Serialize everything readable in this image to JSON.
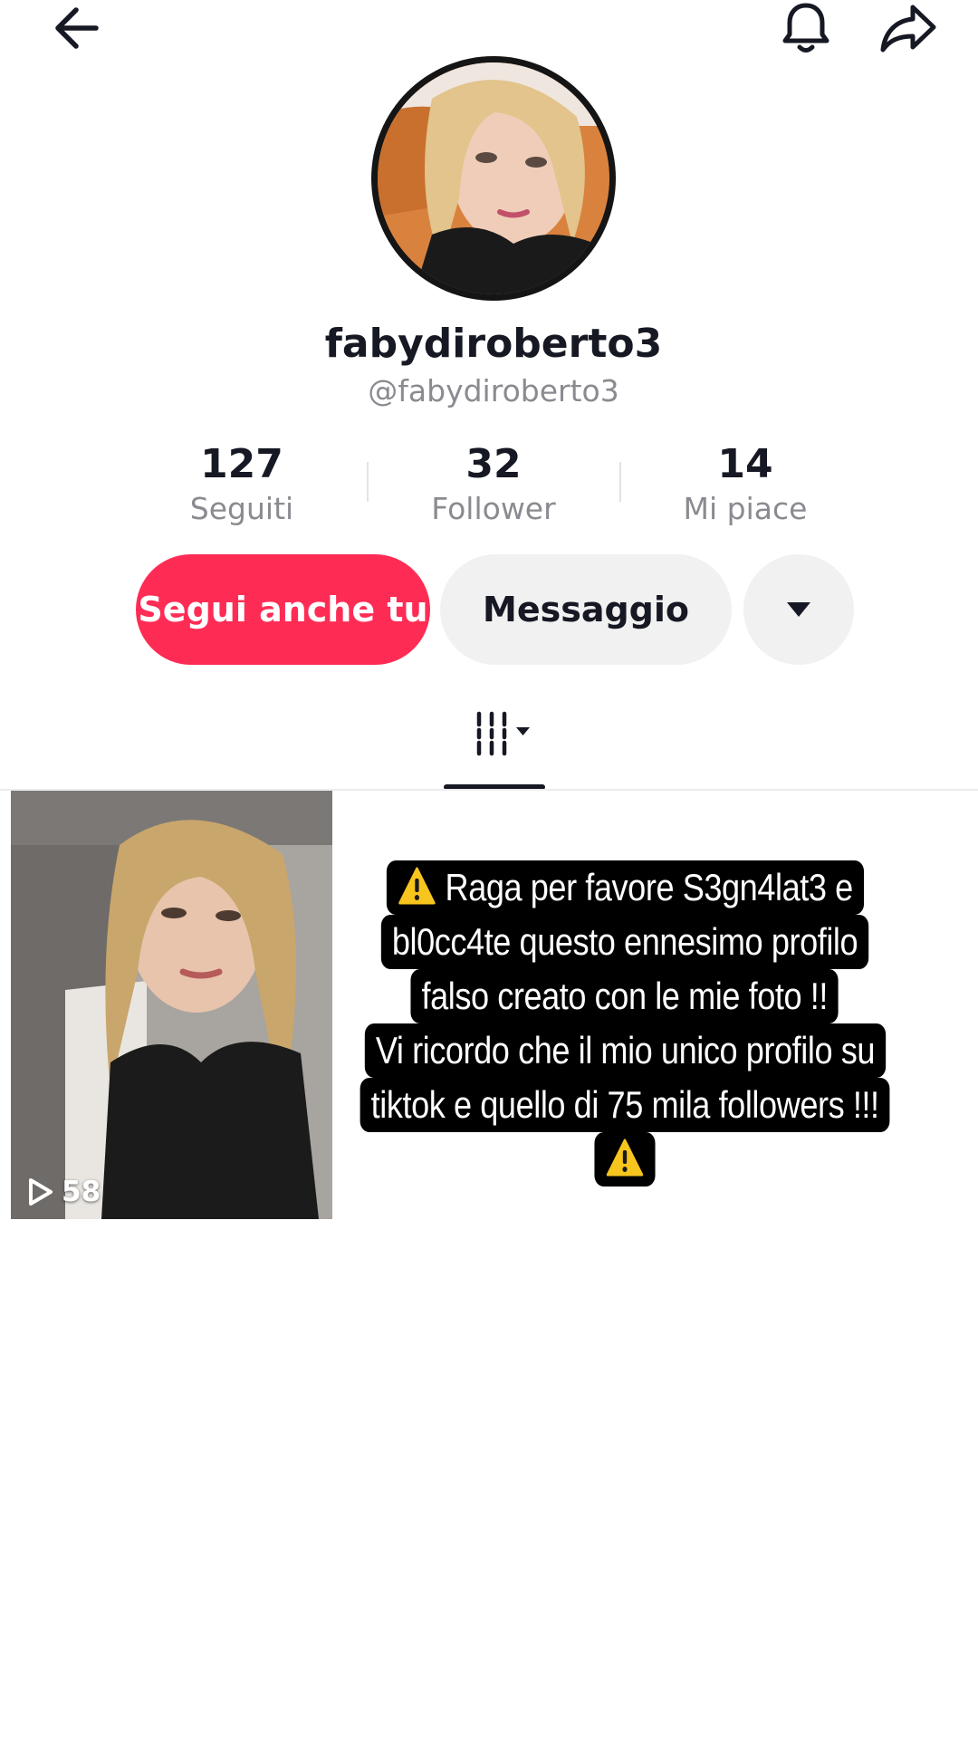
{
  "header": {
    "back_icon": "arrow-left-icon",
    "bell_icon": "bell-icon",
    "share_icon": "share-arrow-icon"
  },
  "profile": {
    "username": "fabydiroberto3",
    "handle": "@fabydiroberto3",
    "stats": [
      {
        "value": "127",
        "label": "Seguiti"
      },
      {
        "value": "32",
        "label": "Follower"
      },
      {
        "value": "14",
        "label": "Mi piace"
      }
    ]
  },
  "actions": {
    "follow_label": "Segui anche tu",
    "message_label": "Messaggio",
    "more_icon": "caret-down-icon"
  },
  "tabs": {
    "grid_icon": "video-grid-icon"
  },
  "videos": [
    {
      "views": "58",
      "play_icon": "play-outline-icon"
    }
  ],
  "overlay": {
    "lines": [
      "Raga per favore S3gn4lat3 e",
      "bl0cc4te questo ennesimo profilo",
      "falso creato con le mie foto !!",
      "Vi ricordo che il mio unico profilo su",
      "tiktok e quello di 75 mila followers !!!"
    ],
    "warning_icon": "warning-sign-icon"
  },
  "colors": {
    "accent": "#fe2c55",
    "secondary_button": "#f1f1f2",
    "text_primary": "#161823",
    "text_secondary": "#8a8b91"
  }
}
